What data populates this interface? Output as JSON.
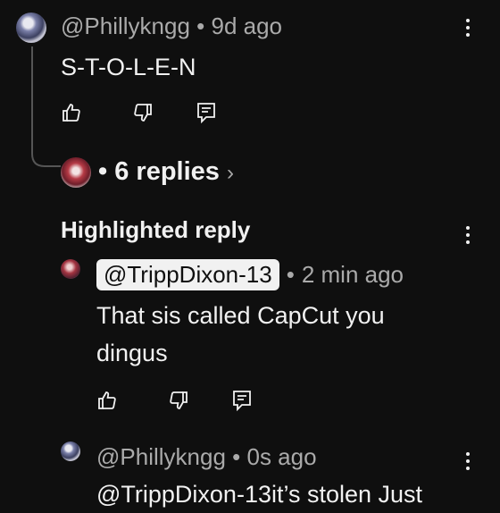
{
  "comment1": {
    "author": "@Phillykngg",
    "age": "9d ago",
    "text": "S-T-O-L-E-N"
  },
  "replies_link": {
    "label": "6 replies",
    "chevron": "›"
  },
  "highlighted": {
    "heading": "Highlighted reply",
    "author": "@TrippDixon-13",
    "age": "2 min ago",
    "text_line1": "That sis called CapCut you",
    "text_line2": "dingus"
  },
  "comment3": {
    "author": "@Phillykngg",
    "age": "0s ago",
    "text": "@TrippDixon-13it’s stolen Just"
  },
  "separator": "•",
  "icons": [
    "like-icon",
    "dislike-icon",
    "reply-icon",
    "more-vert-icon",
    "chevron-right-icon"
  ],
  "colors": {
    "background": "#0f0f0f",
    "text": "#f1f1f1",
    "meta": "#aaaaaa",
    "chip_bg": "#f1f1f1"
  }
}
